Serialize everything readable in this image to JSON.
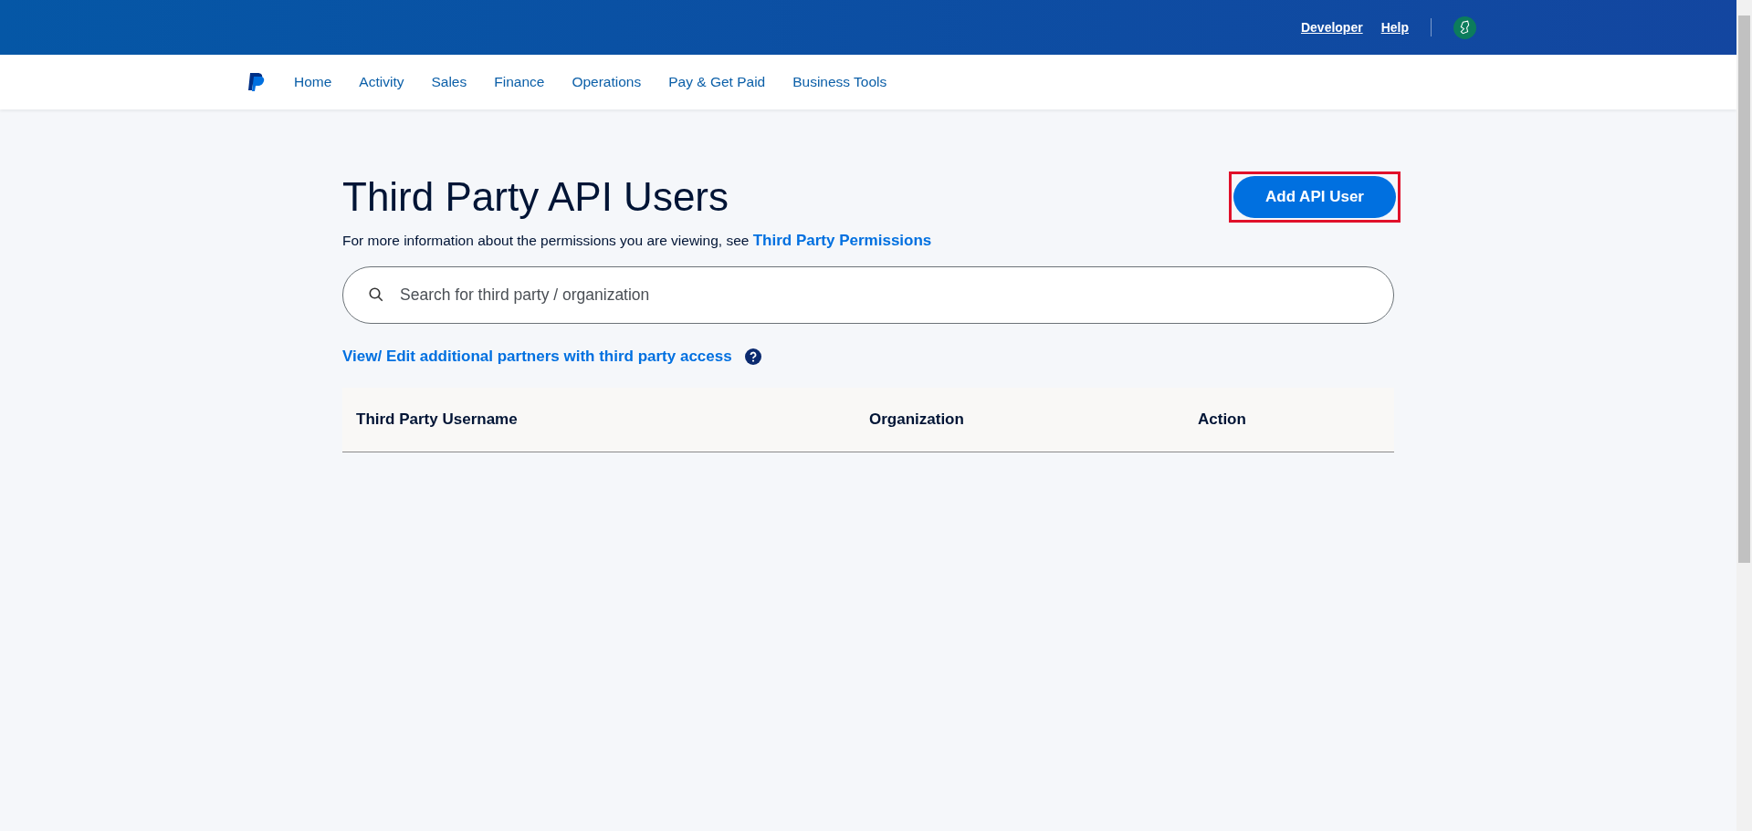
{
  "top_bar": {
    "links": [
      "Developer",
      "Help"
    ]
  },
  "nav": {
    "items": [
      "Home",
      "Activity",
      "Sales",
      "Finance",
      "Operations",
      "Pay & Get Paid",
      "Business Tools"
    ]
  },
  "page": {
    "title": "Third Party API Users",
    "add_button": "Add API User",
    "info_text": "For more information about the permissions you are viewing, see",
    "info_link": "Third Party Permissions",
    "search": {
      "placeholder": "Search for third party / organization"
    },
    "partners_link": "View/ Edit additional partners with third party access"
  },
  "table": {
    "columns": [
      "Third Party Username",
      "Organization",
      "Action"
    ]
  }
}
